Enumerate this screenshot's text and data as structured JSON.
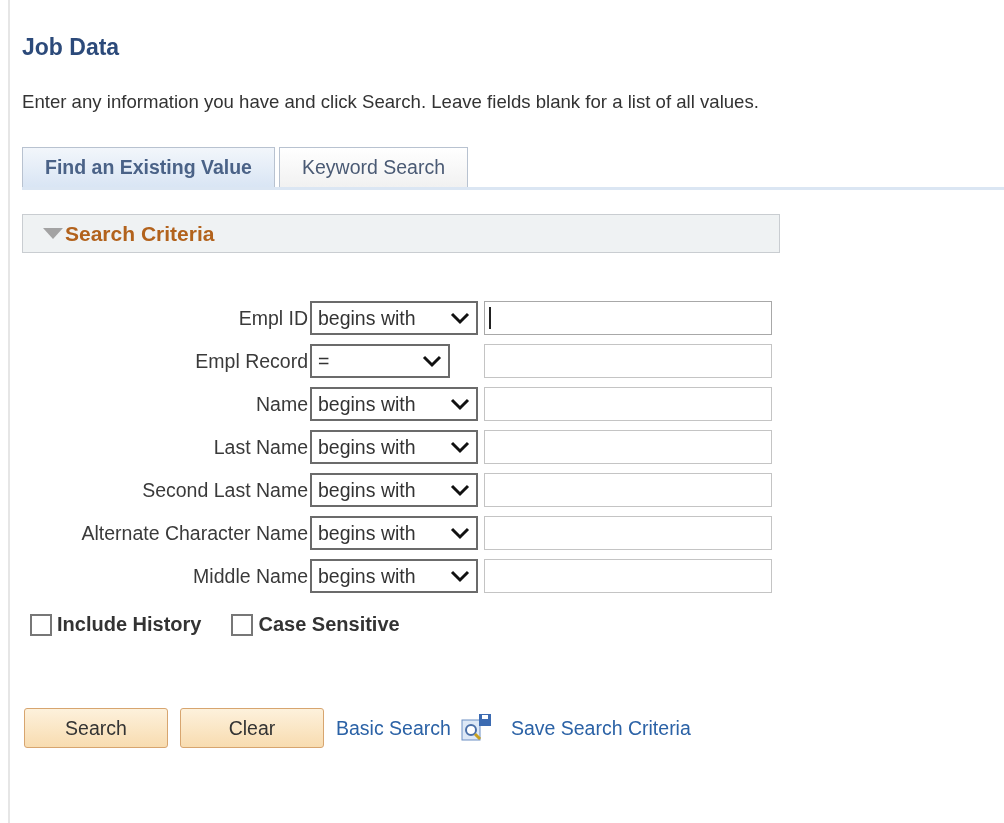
{
  "page": {
    "title": "Job Data",
    "instructions": "Enter any information you have and click Search. Leave fields blank for a list of all values."
  },
  "tabs": [
    {
      "label": "Find an Existing Value",
      "selected": true
    },
    {
      "label": "Keyword Search",
      "selected": false
    }
  ],
  "section": {
    "title": "Search Criteria",
    "expanded": true
  },
  "fields": [
    {
      "label": "Empl ID",
      "operator": "begins with",
      "wide": true,
      "focused": true
    },
    {
      "label": "Empl Record",
      "operator": "=",
      "wide": false,
      "focused": false
    },
    {
      "label": "Name",
      "operator": "begins with",
      "wide": true,
      "focused": false
    },
    {
      "label": "Last Name",
      "operator": "begins with",
      "wide": true,
      "focused": false
    },
    {
      "label": "Second Last Name",
      "operator": "begins with",
      "wide": true,
      "focused": false
    },
    {
      "label": "Alternate Character Name",
      "operator": "begins with",
      "wide": true,
      "focused": false
    },
    {
      "label": "Middle Name",
      "operator": "begins with",
      "wide": true,
      "focused": false
    }
  ],
  "options": [
    {
      "label": "Include History",
      "checked": false
    },
    {
      "label": "Case Sensitive",
      "checked": false
    }
  ],
  "buttons": [
    "Search",
    "Clear"
  ],
  "links": [
    {
      "label": "Basic Search",
      "kind": "link"
    },
    {
      "label": "Save Search Criteria",
      "kind": "icon-link"
    }
  ]
}
